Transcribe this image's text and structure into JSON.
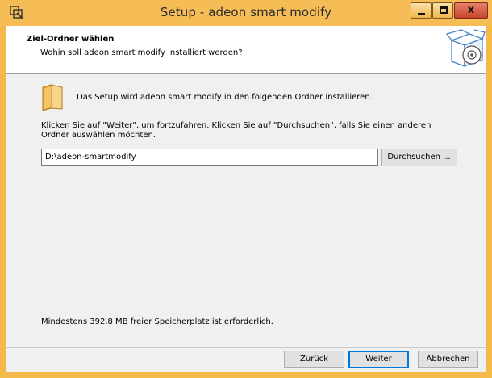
{
  "window": {
    "title": "Setup - adeon smart modify",
    "controls": {
      "minimize_icon": "minimize-icon",
      "maximize_icon": "maximize-icon",
      "close_glyph": "x"
    },
    "accent_color": "#f6bd57"
  },
  "header": {
    "title": "Ziel-Ordner wählen",
    "subtitle": "Wohin soll adeon smart modify installiert werden?",
    "icon": "installer-box-icon"
  },
  "content": {
    "folder_icon": "folder-icon",
    "lead_text": "Das Setup wird adeon smart modify in den folgenden Ordner installieren.",
    "hint_text": "Klicken Sie auf \"Weiter\", um fortzufahren. Klicken Sie auf \"Durchsuchen\", falls Sie einen anderen Ordner auswählen möchten.",
    "path_value": "D:\\adeon-smartmodify",
    "browse_label": "Durchsuchen ...",
    "space_text": "Mindestens 392,8 MB freier Speicherplatz ist erforderlich."
  },
  "footer": {
    "back_label": "Zurück",
    "next_label": "Weiter",
    "cancel_label": "Abbrechen"
  }
}
